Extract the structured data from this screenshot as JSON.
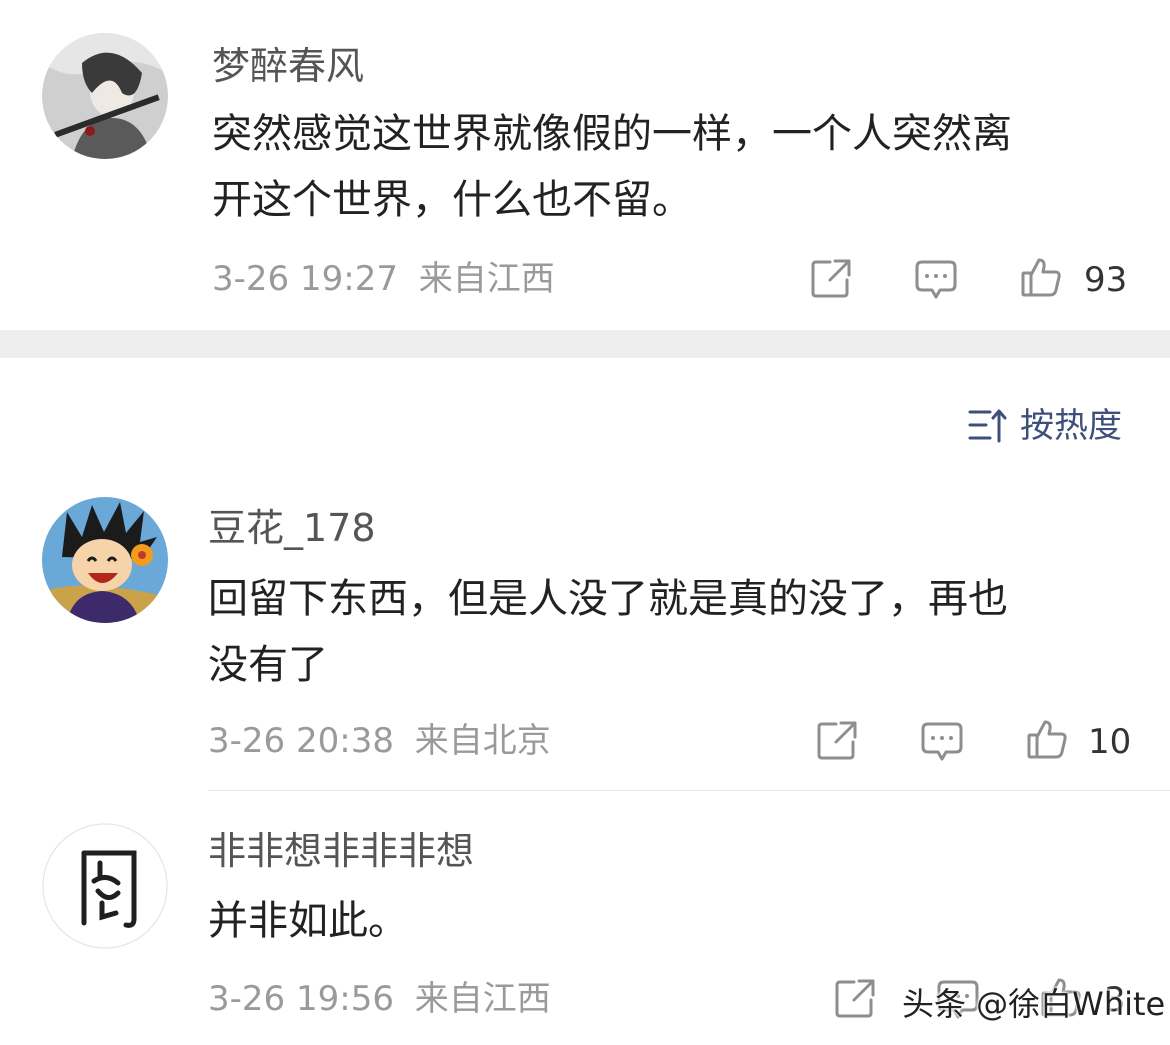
{
  "comments": [
    {
      "username": "梦醉春风",
      "content_lines": [
        "突然感觉这世界就像假的一样，一个人突然离",
        "开这个世界，什么也不留。"
      ],
      "time": "3-26 19:27",
      "location": "来自江西",
      "likes": "93"
    },
    {
      "username": "豆花_178",
      "content_lines": [
        "回留下东西，但是人没了就是真的没了，再也",
        "没有了"
      ],
      "time": "3-26 20:38",
      "location": "来自北京",
      "likes": "10"
    },
    {
      "username": "非非想非非非想",
      "content_lines": [
        "并非如此。"
      ],
      "time": "3-26 19:56",
      "location": "来自江西",
      "likes": "3"
    }
  ],
  "sort": {
    "label": "按热度",
    "icon": "sort-icon"
  },
  "watermark": "头条 @徐白White",
  "icons": {
    "share": "share-icon",
    "reply": "comment-icon",
    "like": "thumbs-up-icon"
  },
  "colors": {
    "sort_accent": "#3d4f7a",
    "meta_gray": "#9a9a9a",
    "separator": "#eeeeee"
  }
}
